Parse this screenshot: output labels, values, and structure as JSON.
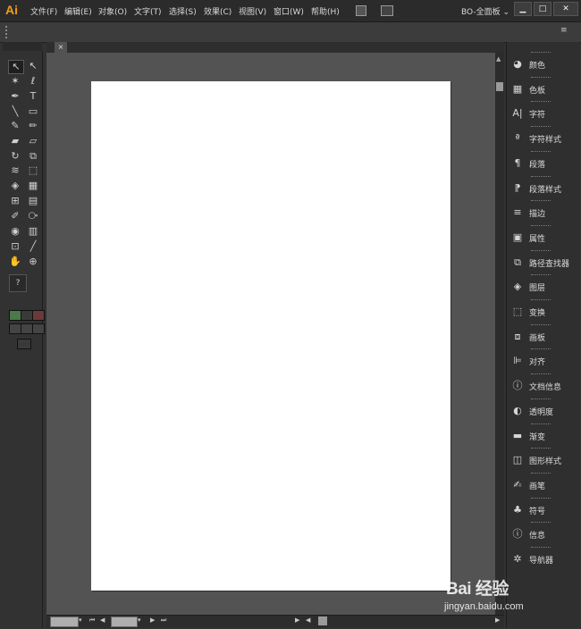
{
  "app": {
    "logo": "Ai"
  },
  "menu": [
    "文件(F)",
    "编辑(E)",
    "对象(O)",
    "文字(T)",
    "选择(S)",
    "效果(C)",
    "视图(V)",
    "窗口(W)",
    "帮助(H)"
  ],
  "workspace": {
    "label": "BO-全面板",
    "arrow": "⌄"
  },
  "window_buttons": {
    "minimize": "▁",
    "maximize": "□",
    "close": "✕"
  },
  "control_bar": {
    "menu_glyph": "≡"
  },
  "document": {
    "tab_close": "×"
  },
  "tools": [
    "selection-tool",
    "direct-selection-tool",
    "magic-wand-tool",
    "lasso-tool",
    "pen-tool",
    "type-tool",
    "line-tool",
    "rectangle-tool",
    "paintbrush-tool",
    "pencil-tool",
    "blob-brush-tool",
    "eraser-tool",
    "rotate-tool",
    "scale-tool",
    "warp-tool",
    "free-transform-tool",
    "shape-builder-tool",
    "perspective-grid-tool",
    "mesh-tool",
    "gradient-tool",
    "eyedropper-tool",
    "blend-tool",
    "symbol-sprayer-tool",
    "column-graph-tool",
    "artboard-tool",
    "slice-tool",
    "hand-tool",
    "zoom-tool"
  ],
  "tool_glyphs": [
    "↖",
    "↖",
    "✶",
    "ℓ",
    "✒",
    "T",
    "╲",
    "▭",
    "✎",
    "✏",
    "▰",
    "▱",
    "↻",
    "⧉",
    "≋",
    "⬚",
    "◈",
    "▦",
    "⊞",
    "▤",
    "✐",
    "⧂",
    "◉",
    "▥",
    "⊡",
    "╱",
    "✋",
    "⊕"
  ],
  "tool_extra": {
    "fill_stroke": "?"
  },
  "panels": [
    {
      "icon": "color-icon",
      "glyph": "◕",
      "label": "颜色"
    },
    {
      "icon": "swatches-icon",
      "glyph": "▦",
      "label": "色板"
    },
    {
      "icon": "character-icon",
      "glyph": "A|",
      "label": "字符"
    },
    {
      "icon": "character-styles-icon",
      "glyph": "ª",
      "label": "字符样式"
    },
    {
      "icon": "paragraph-icon",
      "glyph": "¶",
      "label": "段落"
    },
    {
      "icon": "paragraph-styles-icon",
      "glyph": "⁋",
      "label": "段落样式"
    },
    {
      "icon": "stroke-icon",
      "glyph": "≡",
      "label": "描边"
    },
    {
      "icon": "attributes-icon",
      "glyph": "▣",
      "label": "属性"
    },
    {
      "icon": "pathfinder-icon",
      "glyph": "⧉",
      "label": "路径查找器"
    },
    {
      "icon": "layers-icon",
      "glyph": "◈",
      "label": "图层"
    },
    {
      "icon": "transform-icon",
      "glyph": "⬚",
      "label": "变换"
    },
    {
      "icon": "artboards-icon",
      "glyph": "⧈",
      "label": "画板"
    },
    {
      "icon": "align-icon",
      "glyph": "⊫",
      "label": "对齐"
    },
    {
      "icon": "document-info-icon",
      "glyph": "ⓘ",
      "label": "文档信息"
    },
    {
      "icon": "transparency-icon",
      "glyph": "◐",
      "label": "透明度"
    },
    {
      "icon": "gradient-icon",
      "glyph": "▬",
      "label": "渐变"
    },
    {
      "icon": "graphic-styles-icon",
      "glyph": "◫",
      "label": "图形样式"
    },
    {
      "icon": "brushes-icon",
      "glyph": "✍",
      "label": "画笔"
    },
    {
      "icon": "symbols-icon",
      "glyph": "♣",
      "label": "符号"
    },
    {
      "icon": "info-icon",
      "glyph": "ⓘ",
      "label": "信息"
    },
    {
      "icon": "navigator-icon",
      "glyph": "✲",
      "label": "导航器"
    }
  ],
  "status_bar": {
    "first": "⏮",
    "prev": "◀",
    "next": "▶",
    "last": "⏭",
    "scroll_left": "◀",
    "scroll_right": "▶"
  },
  "watermark": {
    "brand": "Bai 经验",
    "url": "jingyan.baidu.com"
  },
  "colors": {
    "accent": "#f39c12",
    "artboard": "#ffffff",
    "canvas": "#535353",
    "chrome": "#323232"
  }
}
